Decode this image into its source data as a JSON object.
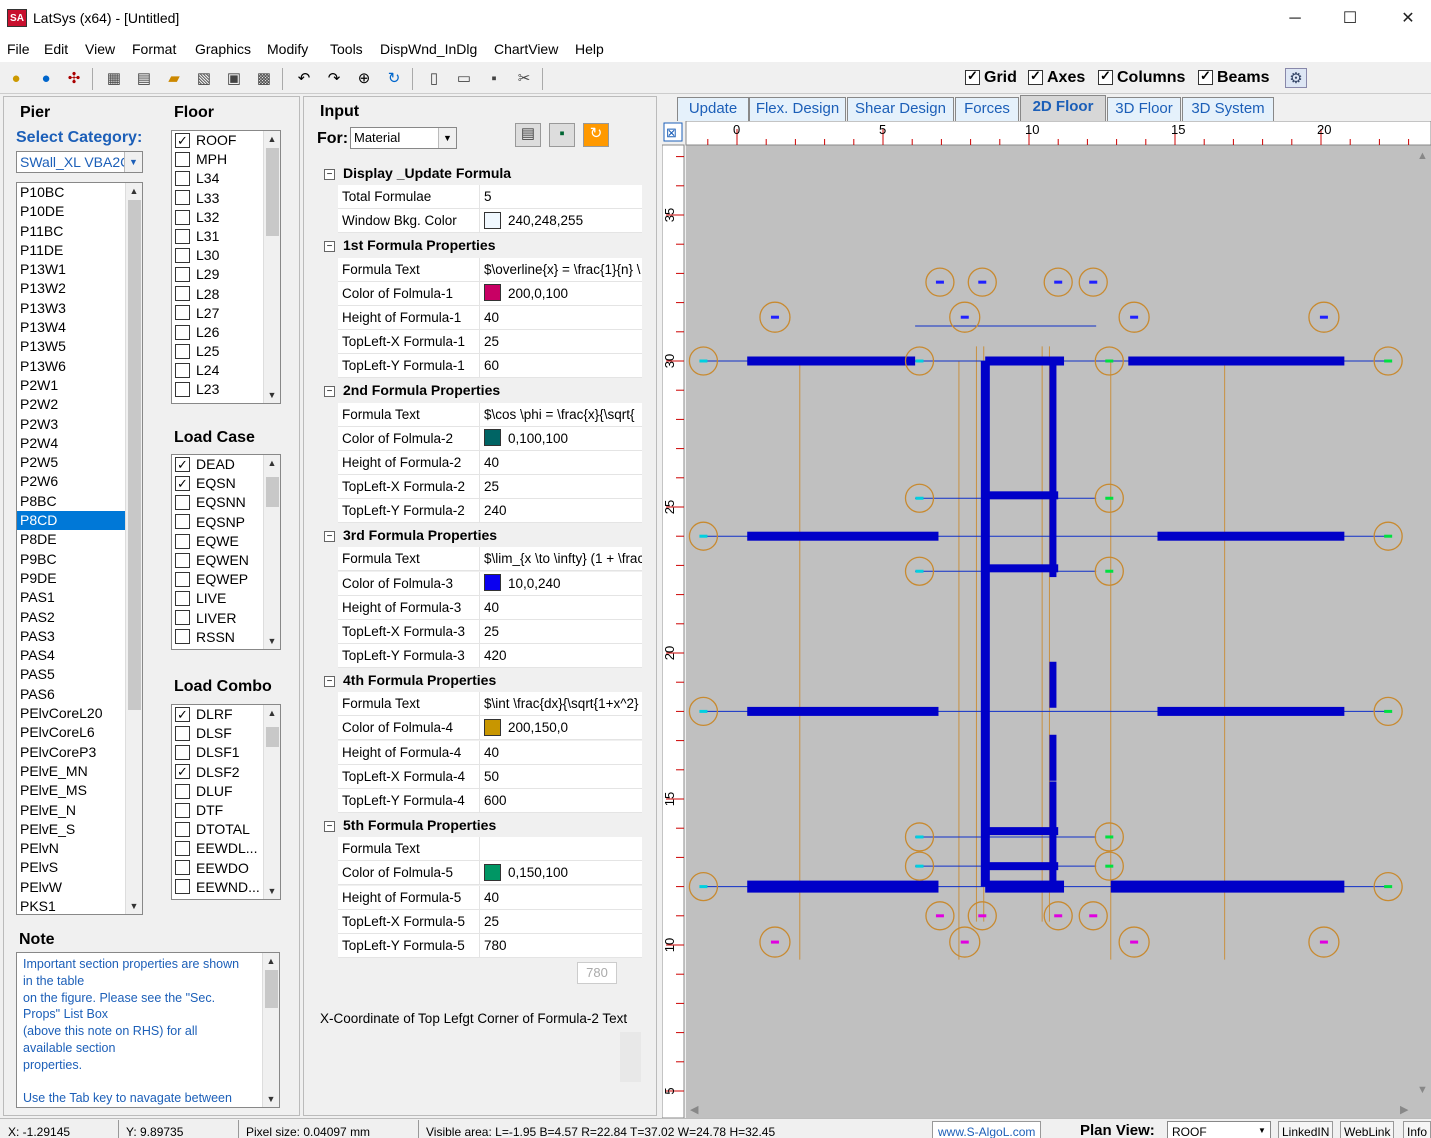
{
  "window": {
    "title": "LatSys (x64) - [Untitled]",
    "icon_label": "SA"
  },
  "menu": [
    "File",
    "Edit",
    "View",
    "Format",
    "Graphics",
    "Modify",
    "Tools",
    "DispWnd_InDlg",
    "ChartView",
    "Help"
  ],
  "toolbar_checks": [
    {
      "label": "Grid",
      "checked": true
    },
    {
      "label": "Axes",
      "checked": true
    },
    {
      "label": "Columns",
      "checked": true
    },
    {
      "label": "Beams",
      "checked": true
    }
  ],
  "pier": {
    "title": "Pier",
    "select_label": "Select Category:",
    "category": "SWall_XL VBA2C",
    "items": [
      "P10BC",
      "P10DE",
      "P11BC",
      "P11DE",
      "P13W1",
      "P13W2",
      "P13W3",
      "P13W4",
      "P13W5",
      "P13W6",
      "P2W1",
      "P2W2",
      "P2W3",
      "P2W4",
      "P2W5",
      "P2W6",
      "P8BC",
      "P8CD",
      "P8DE",
      "P9BC",
      "P9DE",
      "PAS1",
      "PAS2",
      "PAS3",
      "PAS4",
      "PAS5",
      "PAS6",
      "PElvCoreL20",
      "PElvCoreL6",
      "PElvCoreP3",
      "PElvE_MN",
      "PElvE_MS",
      "PElvE_N",
      "PElvE_S",
      "PElvN",
      "PElvS",
      "PElvW",
      "PKS1"
    ],
    "selected": "P8CD"
  },
  "floor": {
    "title": "Floor",
    "items": [
      {
        "label": "ROOF",
        "checked": true
      },
      {
        "label": "MPH",
        "checked": false
      },
      {
        "label": "L34",
        "checked": false
      },
      {
        "label": "L33",
        "checked": false
      },
      {
        "label": "L32",
        "checked": false
      },
      {
        "label": "L31",
        "checked": false
      },
      {
        "label": "L30",
        "checked": false
      },
      {
        "label": "L29",
        "checked": false
      },
      {
        "label": "L28",
        "checked": false
      },
      {
        "label": "L27",
        "checked": false
      },
      {
        "label": "L26",
        "checked": false
      },
      {
        "label": "L25",
        "checked": false
      },
      {
        "label": "L24",
        "checked": false
      },
      {
        "label": "L23",
        "checked": false
      }
    ]
  },
  "load_case": {
    "title": "Load Case",
    "items": [
      {
        "label": "DEAD",
        "checked": true
      },
      {
        "label": "EQSN",
        "checked": true
      },
      {
        "label": "EQSNN",
        "checked": false
      },
      {
        "label": "EQSNP",
        "checked": false
      },
      {
        "label": "EQWE",
        "checked": false
      },
      {
        "label": "EQWEN",
        "checked": false
      },
      {
        "label": "EQWEP",
        "checked": false
      },
      {
        "label": "LIVE",
        "checked": false
      },
      {
        "label": "LIVER",
        "checked": false
      },
      {
        "label": "RSSN",
        "checked": false
      }
    ]
  },
  "load_combo": {
    "title": "Load Combo",
    "items": [
      {
        "label": "DLRF",
        "checked": true
      },
      {
        "label": "DLSF",
        "checked": false
      },
      {
        "label": "DLSF1",
        "checked": false
      },
      {
        "label": "DLSF2",
        "checked": true
      },
      {
        "label": "DLUF",
        "checked": false
      },
      {
        "label": "DTF",
        "checked": false
      },
      {
        "label": "DTOTAL",
        "checked": false
      },
      {
        "label": "EEWDL...",
        "checked": false
      },
      {
        "label": "EEWDO",
        "checked": false
      },
      {
        "label": "EEWND...",
        "checked": false
      }
    ]
  },
  "note": {
    "title": "Note",
    "lines": [
      "Important section properties are shown",
      "in the table",
      "on the figure. Please see the \"Sec.",
      "Props\" List Box",
      "(above this note on RHS) for all",
      "available section",
      "properties.",
      "",
      "Use the Tab key to navagate between"
    ]
  },
  "input": {
    "title": "Input",
    "for_label": "For:",
    "for_value": "Material",
    "sections": [
      {
        "title": "Display _Update Formula",
        "rows": [
          {
            "label": "Total Formulae",
            "value": "5"
          },
          {
            "label": "Window Bkg. Color",
            "value": "240,248,255",
            "color": "#f0f8ff"
          }
        ]
      },
      {
        "title": "1st Formula Properties",
        "rows": [
          {
            "label": "Formula Text",
            "value": "$\\overline{x} = \\frac{1}{n} \\"
          },
          {
            "label": "Color of Folmula-1",
            "value": "200,0,100",
            "color": "#c80064"
          },
          {
            "label": "Height of Formula-1",
            "value": "40"
          },
          {
            "label": "TopLeft-X Formula-1",
            "value": "25"
          },
          {
            "label": "TopLeft-Y Formula-1",
            "value": "60"
          }
        ]
      },
      {
        "title": "2nd Formula Properties",
        "rows": [
          {
            "label": "Formula Text",
            "value": "$\\cos \\phi = \\frac{x}{\\sqrt{"
          },
          {
            "label": "Color of Folmula-2",
            "value": "0,100,100",
            "color": "#006464"
          },
          {
            "label": "Height of Formula-2",
            "value": "40"
          },
          {
            "label": "TopLeft-X Formula-2",
            "value": "25"
          },
          {
            "label": "TopLeft-Y Formula-2",
            "value": "240"
          }
        ]
      },
      {
        "title": "3rd Formula Properties",
        "rows": [
          {
            "label": "Formula Text",
            "value": "$\\lim_{x \\to \\infty} (1 + \\frac"
          },
          {
            "label": "Color of Folmula-3",
            "value": "10,0,240",
            "color": "#0a00f0"
          },
          {
            "label": "Height of Formula-3",
            "value": "40"
          },
          {
            "label": "TopLeft-X Formula-3",
            "value": "25"
          },
          {
            "label": "TopLeft-Y Formula-3",
            "value": "420"
          }
        ]
      },
      {
        "title": "4th Formula Properties",
        "rows": [
          {
            "label": "Formula Text",
            "value": "$\\int \\frac{dx}{\\sqrt{1+x^2}"
          },
          {
            "label": "Color of Folmula-4",
            "value": "200,150,0",
            "color": "#c89600"
          },
          {
            "label": "Height of Formula-4",
            "value": "40"
          },
          {
            "label": "TopLeft-X Formula-4",
            "value": "50"
          },
          {
            "label": "TopLeft-Y Formula-4",
            "value": "600"
          }
        ]
      },
      {
        "title": "5th Formula Properties",
        "rows": [
          {
            "label": "Formula Text",
            "value": ""
          },
          {
            "label": "Color of Folmula-5",
            "value": "0,150,100",
            "color": "#009664"
          },
          {
            "label": "Height of Formula-5",
            "value": "40"
          },
          {
            "label": "TopLeft-X Formula-5",
            "value": "25"
          },
          {
            "label": "TopLeft-Y Formula-5",
            "value": "780"
          }
        ]
      }
    ],
    "edit_value": "780",
    "description": "X-Coordinate of Top Lefgt Corner of Formula-2 Text"
  },
  "tabs": [
    "Update",
    "Flex. Design",
    "Shear Design",
    "Forces",
    "2D Floor",
    "3D Floor",
    "3D System"
  ],
  "active_tab": "2D Floor",
  "plan": {
    "x_ticks": [
      "0",
      "5",
      "10",
      "15",
      "20"
    ],
    "y_ticks": [
      "35",
      "30",
      "25",
      "20",
      "15",
      "10",
      "5"
    ]
  },
  "status": {
    "x": "X: -1.29145",
    "y": "Y: 9.89735",
    "pixel": "Pixel size: 0.04097 mm",
    "visible": "Visible area:  L=-1.95  B=4.57  R=22.84  T=37.02   W=24.78  H=32.45",
    "link": "www.S-AlgoL.com",
    "plan_label": "Plan View:",
    "plan_value": "ROOF",
    "btn_linkedin": "LinkedIN",
    "btn_weblink": "WebLink",
    "btn_info": "Info"
  }
}
